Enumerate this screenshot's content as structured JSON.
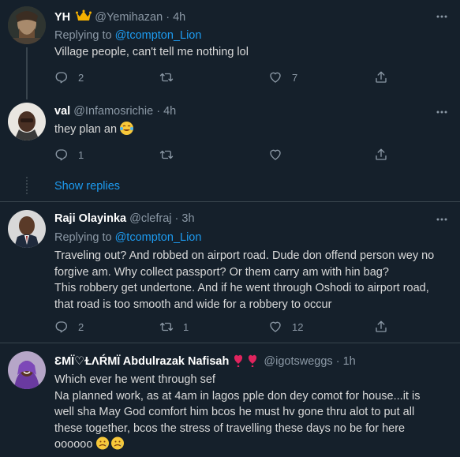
{
  "tweets": [
    {
      "name": "YH",
      "badge": "crown-emoji",
      "handle": "@Yemihazan",
      "separator": "·",
      "time": "4h",
      "replying_prefix": "Replying to",
      "replying_to": "@tcompton_Lion",
      "text": "Village people, can't tell me nothing lol",
      "replies": "2",
      "retweets": "",
      "likes": "7"
    },
    {
      "name": "val",
      "handle": "@Infamosrichie",
      "separator": "·",
      "time": "4h",
      "text": "they plan an",
      "text_emoji": "tears-of-joy-emoji",
      "replies": "1",
      "retweets": "",
      "likes": ""
    },
    {
      "name": "Raji Olayinka",
      "handle": "@clefraj",
      "separator": "·",
      "time": "3h",
      "replying_prefix": "Replying to",
      "replying_to": "@tcompton_Lion",
      "text_lines": [
        "Traveling out? And robbed on airport road. Dude don offend person wey no",
        "forgive am. Why collect passport? Or them carry am with hin bag?",
        "This robbery get undertone. And if he went through Oshodi to airport road,",
        "that road is too smooth and wide for a robbery to occur"
      ],
      "replies": "2",
      "retweets": "1",
      "likes": "12"
    },
    {
      "name": "ƐMÏ♡ⱢΛŔMÏ Abdulrazak Nafisah",
      "name_emoji": "heart-exclamation-emoji",
      "handle": "@igotsweggs",
      "separator": "·",
      "time": "1h",
      "text_lines": [
        "Which ever he went through sef",
        "Na planned work, as at 4am in lagos pple don dey comot for house...it is",
        "well sha May God comfort him bcos he must hv gone thru alot to put all",
        "these together, bcos the stress of travelling these days no be for here",
        "oooooo"
      ],
      "text_emoji": "sad-face-emoji"
    }
  ],
  "show_replies": "Show replies",
  "colors": {
    "background": "#15202b",
    "accent": "#1d9bf0",
    "muted": "#8b98a5",
    "divider": "#38444d"
  }
}
